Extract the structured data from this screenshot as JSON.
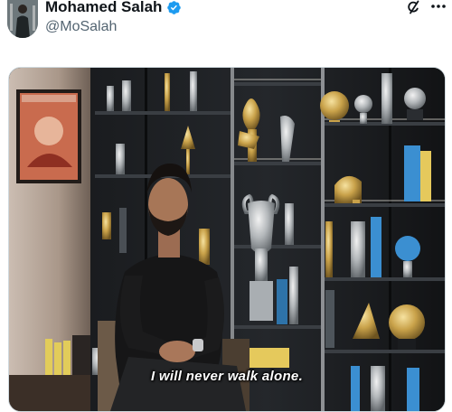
{
  "post": {
    "author": {
      "name": "Mohamed Salah",
      "handle": "@MoSalah",
      "verified": true,
      "avatar_icon": "profile-photo",
      "verified_color": "#1d9bf0"
    },
    "actions": {
      "grok_icon": "grok-icon",
      "more_icon": "more-options-icon"
    },
    "media": {
      "type": "video-still",
      "subtitle": "I will never walk alone."
    }
  },
  "colors": {
    "text_primary": "#0f1419",
    "text_secondary": "#536471",
    "border": "#cfd9de"
  }
}
